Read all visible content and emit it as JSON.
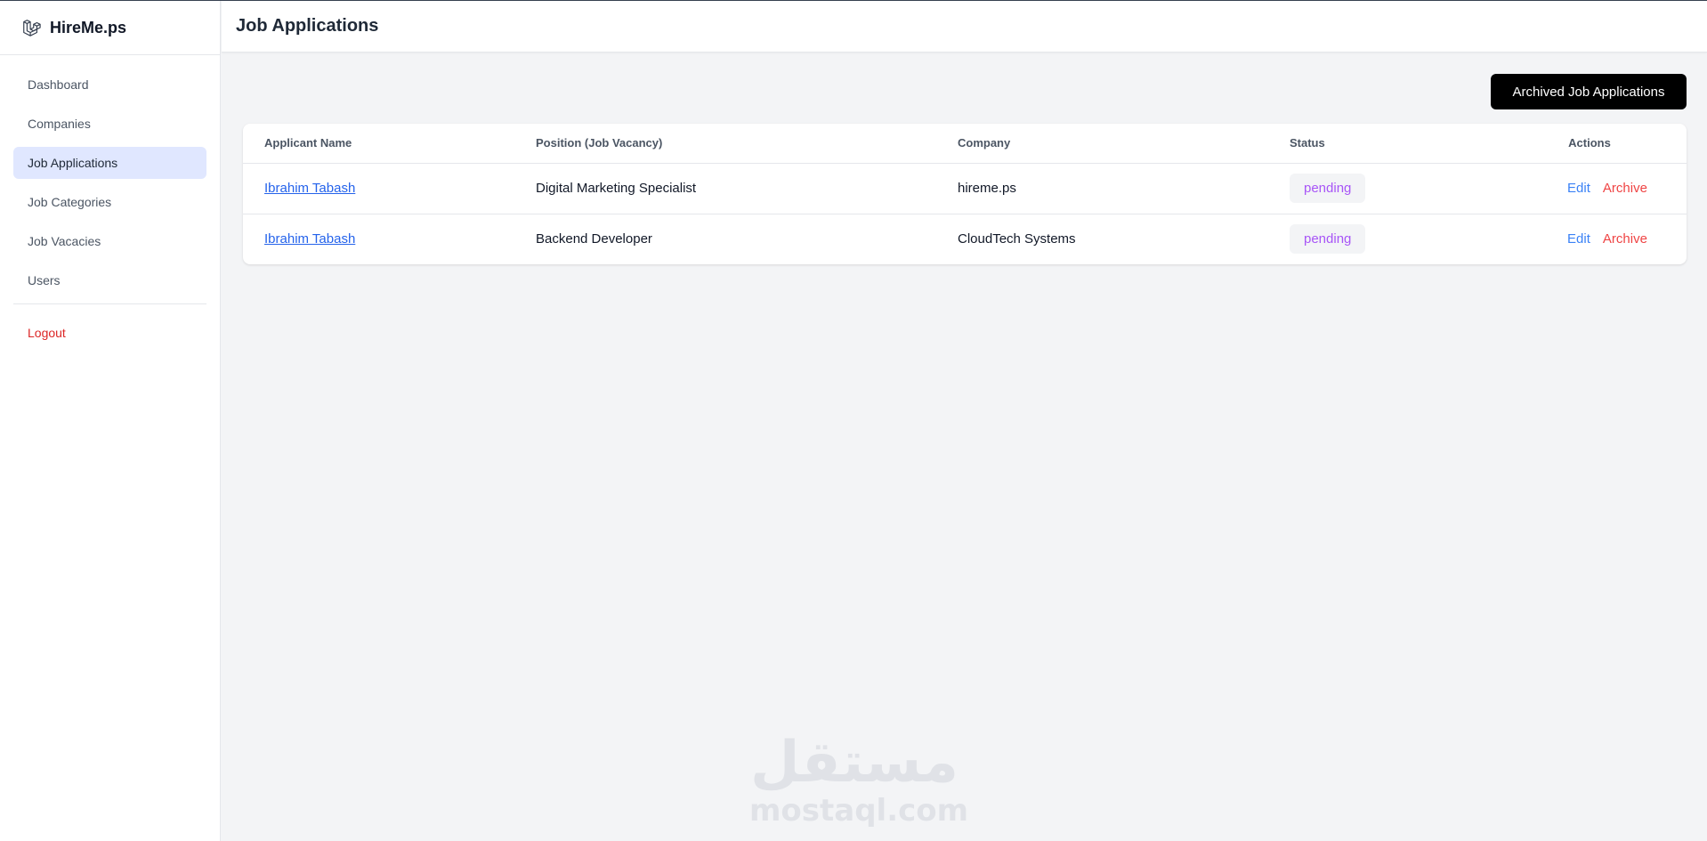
{
  "app": {
    "name": "HireMe.ps",
    "logo_icon": "laravel-logo-icon"
  },
  "sidebar": {
    "items": [
      {
        "label": "Dashboard",
        "active": false
      },
      {
        "label": "Companies",
        "active": false
      },
      {
        "label": "Job Applications",
        "active": true
      },
      {
        "label": "Job Categories",
        "active": false
      },
      {
        "label": "Job Vacacies",
        "active": false
      },
      {
        "label": "Users",
        "active": false
      }
    ],
    "logout_label": "Logout"
  },
  "header": {
    "title": "Job Applications"
  },
  "toolbar": {
    "archived_label": "Archived Job Applications"
  },
  "table": {
    "columns": [
      "Applicant Name",
      "Position (Job Vacancy)",
      "Company",
      "Status",
      "Actions"
    ],
    "rows": [
      {
        "applicant": "Ibrahim Tabash",
        "position": "Digital Marketing Specialist",
        "company": "hireme.ps",
        "status": "pending",
        "edit_label": "Edit",
        "archive_label": "Archive"
      },
      {
        "applicant": "Ibrahim Tabash",
        "position": "Backend Developer",
        "company": "CloudTech Systems",
        "status": "pending",
        "edit_label": "Edit",
        "archive_label": "Archive"
      }
    ]
  },
  "watermark": {
    "arabic": "مستقل",
    "latin": "mostaql.com"
  },
  "colors": {
    "active_nav_bg": "#e0e7ff",
    "logout": "#dc2626",
    "link": "#2563eb",
    "status_text": "#a855f7",
    "edit": "#3b82f6",
    "archive": "#ef4444",
    "primary_button": "#000000"
  }
}
